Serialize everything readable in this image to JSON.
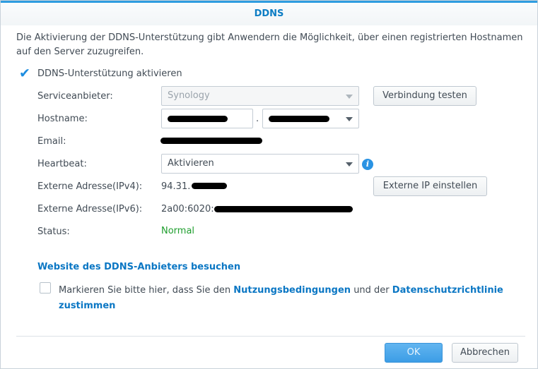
{
  "dialog": {
    "title": "DDNS",
    "description": "Die Aktivierung der DDNS-Unterstützung gibt Anwendern die Möglichkeit, über einen registrierten Hostnamen auf den Server zuzugreifen.",
    "enable_label": "DDNS-Unterstützung aktivieren",
    "enable_checked": true
  },
  "form": {
    "provider_label": "Serviceanbieter:",
    "provider_value": "Synology",
    "hostname_label": "Hostname:",
    "hostname_separator": ".",
    "email_label": "Email:",
    "heartbeat_label": "Heartbeat:",
    "heartbeat_value": "Aktivieren",
    "ipv4_label": "Externe Adresse(IPv4):",
    "ipv4_value": "94.31.",
    "ipv6_label": "Externe Adresse(IPv6):",
    "ipv6_value": "2a00:6020:",
    "status_label": "Status:",
    "status_value": "Normal",
    "status_color": "#1f9e2e"
  },
  "buttons": {
    "test_connection": "Verbindung testen",
    "set_external_ip": "Externe IP einstellen",
    "ok": "OK",
    "cancel": "Abbrechen"
  },
  "links": {
    "provider_website": "Website des DDNS-Anbieters besuchen"
  },
  "terms": {
    "prefix": "Markieren Sie bitte hier, dass Sie den ",
    "terms_link": "Nutzungsbedingungen",
    "middle": " und der ",
    "privacy_link": "Datenschutzrichtlinie",
    "suffix_link": "zustimmen",
    "checked": false
  },
  "colors": {
    "accent": "#2e9ce0",
    "link": "#0b77c4"
  }
}
